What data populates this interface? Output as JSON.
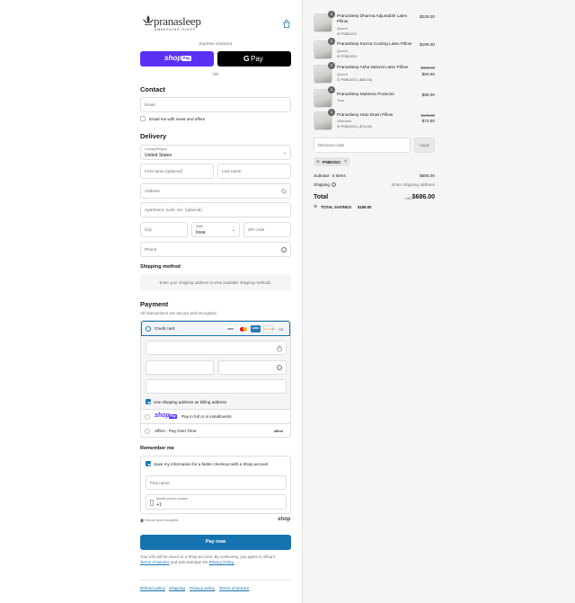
{
  "brand": {
    "name": "pranasleep",
    "tagline": "AWAKENING SLEEP"
  },
  "express": {
    "label": "Express checkout",
    "shop_pay": "shop",
    "shop_pay_badge": "Pay",
    "gpay": "Pay",
    "or": "OR"
  },
  "contact": {
    "title": "Contact",
    "email_placeholder": "Email",
    "newsletter_label": "Email me with news and offers"
  },
  "delivery": {
    "title": "Delivery",
    "country_label": "Country/Region",
    "country_value": "United States",
    "first_name": "First name (optional)",
    "last_name": "Last name",
    "address": "Address",
    "apartment": "Apartment, suite, etc. (optional)",
    "city": "City",
    "state_label": "State",
    "state_value": "Iowa",
    "zip": "ZIP code",
    "phone": "Phone"
  },
  "shipping_method": {
    "title": "Shipping method",
    "placeholder": "Enter your shipping address to view available shipping methods."
  },
  "payment": {
    "title": "Payment",
    "subtitle": "All transactions are secure and encrypted.",
    "credit_card": "Credit card",
    "cards": [
      "VISA",
      "MC",
      "AMEX",
      "DISCOVER"
    ],
    "more_cards": "+3",
    "billing_label": "Use shipping address as billing address",
    "shop_pay_option": "Pay in full or in installments",
    "shop_pay_logo": "shop",
    "shop_pay_badge": "Pay",
    "affirm_option": "Affirm - Pay Over Time",
    "affirm_logo": "affirm"
  },
  "remember": {
    "title": "Remember me",
    "save_label": "Save my information for a faster checkout with a Shop account",
    "first_name": "First name",
    "mobile_label": "Mobile phone number",
    "mobile_value": "+1",
    "secure": "Secure and encrypted",
    "shop_logo": "shop"
  },
  "pay_now": "Pay now",
  "legal": {
    "text_1": "Your info will be saved to a Shop account. By continuing, you agree to Shop's",
    "terms": "Terms of Service",
    "text_2": "and acknowledge the",
    "privacy": "Privacy Policy."
  },
  "footer": [
    "Refund policy",
    "Shipping",
    "Privacy policy",
    "Terms of service"
  ],
  "cart": {
    "items": [
      {
        "qty": "1",
        "name": "PranaSleep Dharma Adjustable Latex Pillow",
        "variant": "Queen",
        "tag": "PSBOGO",
        "price": "$229.00",
        "compare": ""
      },
      {
        "qty": "1",
        "name": "PranaSleep Karma Cooling Latex Pillow",
        "variant": "Queen",
        "tag": "PSBOGO",
        "price": "$199.00",
        "compare": ""
      },
      {
        "qty": "1",
        "name": "PranaSleep Asha Natural Latex Pillow",
        "variant": "Queen",
        "tag": "PSBOGO (-$84.50)",
        "price": "$84.50",
        "compare": "$169.00"
      },
      {
        "qty": "1",
        "name": "PranaSleep Mattress Protector",
        "variant": "Twin",
        "tag": "",
        "price": "$99.00",
        "compare": ""
      },
      {
        "qty": "1",
        "name": "PranaSleep Halo Down Pillow",
        "variant": "Standard",
        "tag": "PSBOGO (-$74.50)",
        "price": "$74.50",
        "compare": "$149.00"
      }
    ],
    "discount_placeholder": "Discount code",
    "apply": "Apply",
    "applied_code": "PSBOGO",
    "subtotal_label": "Subtotal · 5 items",
    "subtotal_value": "$686.00",
    "shipping_label": "Shipping",
    "shipping_value": "Enter shipping address",
    "total_label": "Total",
    "currency": "USD",
    "total_value": "$686.00",
    "savings_label": "TOTAL SAVINGS",
    "savings_value": "$159.00"
  },
  "colors": {
    "accent": "#1773b0",
    "shop_pay": "#5a31f4",
    "background_right": "#f5f5f5"
  }
}
